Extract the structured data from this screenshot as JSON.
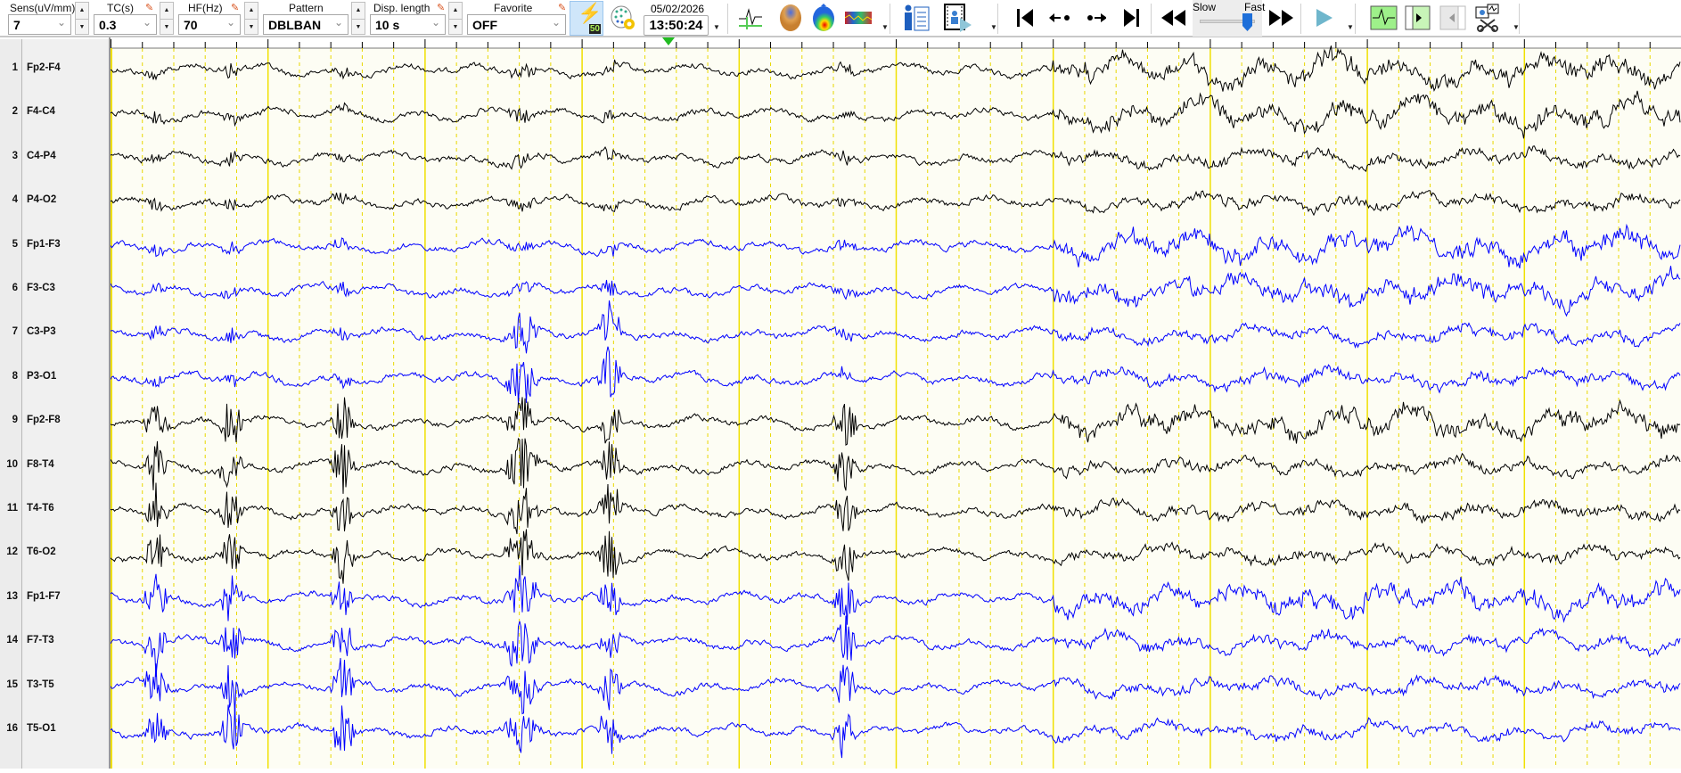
{
  "toolbar": {
    "sens": {
      "label": "Sens(uV/mm)",
      "value": "7"
    },
    "tc": {
      "label": "TC(s)",
      "value": "0.3"
    },
    "hf": {
      "label": "HF(Hz)",
      "value": "70"
    },
    "pattern": {
      "label": "Pattern",
      "value": "DBLBAN"
    },
    "disp_length": {
      "label": "Disp. length",
      "value": "10 s"
    },
    "favorite": {
      "label": "Favorite",
      "value": "OFF"
    },
    "notch_badge": "50",
    "date": "05/02/2026",
    "time": "13:50:24",
    "speed": {
      "slow_label": "Slow",
      "fast_label": "Fast",
      "value_fraction": 0.85
    }
  },
  "channels": [
    {
      "num": "1",
      "label": "Fp2-F4",
      "color": "#000000"
    },
    {
      "num": "2",
      "label": "F4-C4",
      "color": "#000000"
    },
    {
      "num": "3",
      "label": "C4-P4",
      "color": "#000000"
    },
    {
      "num": "4",
      "label": "P4-O2",
      "color": "#000000"
    },
    {
      "num": "5",
      "label": "Fp1-F3",
      "color": "#0000ff"
    },
    {
      "num": "6",
      "label": "F3-C3",
      "color": "#0000ff"
    },
    {
      "num": "7",
      "label": "C3-P3",
      "color": "#0000ff"
    },
    {
      "num": "8",
      "label": "P3-O1",
      "color": "#0000ff"
    },
    {
      "num": "9",
      "label": "Fp2-F8",
      "color": "#000000"
    },
    {
      "num": "10",
      "label": "F8-T4",
      "color": "#000000"
    },
    {
      "num": "11",
      "label": "T4-T6",
      "color": "#000000"
    },
    {
      "num": "12",
      "label": "T6-O2",
      "color": "#000000"
    },
    {
      "num": "13",
      "label": "Fp1-F7",
      "color": "#0000ff"
    },
    {
      "num": "14",
      "label": "F7-T3",
      "color": "#0000ff"
    },
    {
      "num": "15",
      "label": "T3-T5",
      "color": "#0000ff"
    },
    {
      "num": "16",
      "label": "T5-O1",
      "color": "#0000ff"
    }
  ],
  "colors": {
    "grid_second": "#f0e000",
    "grid_sub": "#e8d800",
    "marker": "#22bb22",
    "background": "#fdfdf4"
  }
}
